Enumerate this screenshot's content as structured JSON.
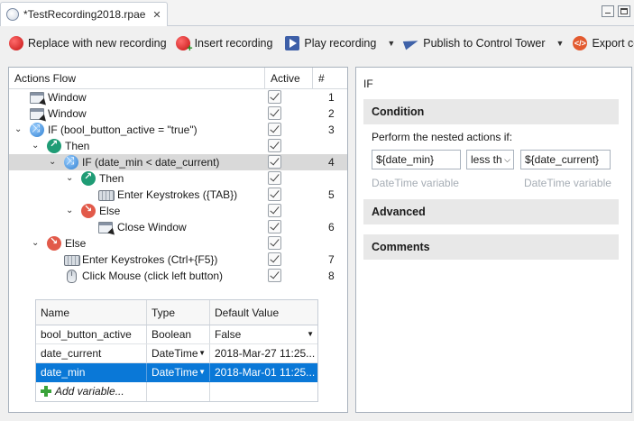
{
  "tab": {
    "title": "*TestRecording2018.rpae",
    "close": "✕"
  },
  "toolbar": {
    "replace": "Replace with new recording",
    "insert": "Insert recording",
    "play": "Play recording",
    "publish": "Publish to Control Tower",
    "export": "Export code",
    "export_icon_text": "</>",
    "dropdown_glyph": "▼"
  },
  "flow": {
    "headers": {
      "actions": "Actions Flow",
      "active": "Active",
      "num": "#"
    },
    "rows": [
      {
        "label": "Window",
        "num": "1"
      },
      {
        "label": "Window",
        "num": "2"
      },
      {
        "label": "IF (bool_button_active = \"true\")",
        "num": "3"
      },
      {
        "label": "Then",
        "num": ""
      },
      {
        "label": "IF (date_min < date_current)",
        "num": "4"
      },
      {
        "label": "Then",
        "num": ""
      },
      {
        "label": "Enter Keystrokes ({TAB})",
        "num": "5"
      },
      {
        "label": "Else",
        "num": ""
      },
      {
        "label": "Close Window",
        "num": "6"
      },
      {
        "label": "Else",
        "num": ""
      },
      {
        "label": "Enter Keystrokes (Ctrl+{F5})",
        "num": "7"
      },
      {
        "label": "Click Mouse (click left button)",
        "num": "8"
      }
    ]
  },
  "variables": {
    "headers": {
      "name": "Name",
      "type": "Type",
      "default": "Default Value"
    },
    "rows": [
      {
        "name": "bool_button_active",
        "type": "Boolean",
        "default": "False"
      },
      {
        "name": "date_current",
        "type": "DateTime",
        "default": "2018-Mar-27 11:25..."
      },
      {
        "name": "date_min",
        "type": "DateTime",
        "default": "2018-Mar-01 11:25..."
      }
    ],
    "add": "Add variable..."
  },
  "panel": {
    "title": "IF",
    "condition": "Condition",
    "perform": "Perform the nested actions if:",
    "left_operand": "${date_min}",
    "operator": "less th",
    "right_operand": "${date_current}",
    "left_hint": "DateTime variable",
    "right_hint": "DateTime variable",
    "advanced": "Advanced",
    "comments": "Comments"
  }
}
